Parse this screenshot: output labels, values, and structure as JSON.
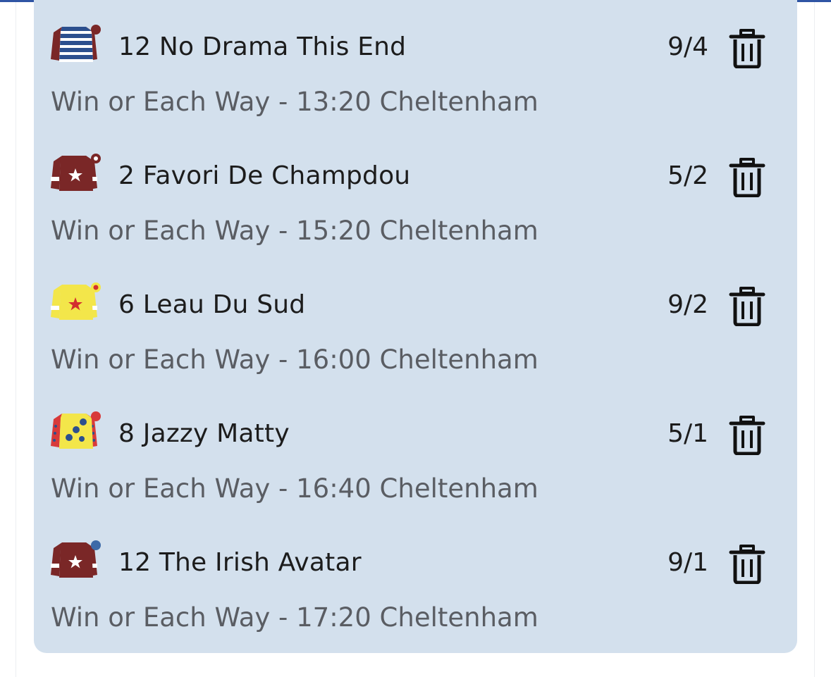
{
  "bets": [
    {
      "selection": "12 No Drama This End",
      "odds": "9/4",
      "market": "Win or Each Way - 13:20 Cheltenham",
      "silk_icon": "blue-white-hooped-silk-icon",
      "delete_icon": "trash-icon"
    },
    {
      "selection": "2 Favori De Champdou",
      "odds": "5/2",
      "market": "Win or Each Way - 15:20 Cheltenham",
      "silk_icon": "maroon-star-silk-icon",
      "delete_icon": "trash-icon"
    },
    {
      "selection": "6 Leau Du Sud",
      "odds": "9/2",
      "market": "Win or Each Way - 16:00 Cheltenham",
      "silk_icon": "yellow-red-star-silk-icon",
      "delete_icon": "trash-icon"
    },
    {
      "selection": "8 Jazzy Matty",
      "odds": "5/1",
      "market": "Win or Each Way - 16:40 Cheltenham",
      "silk_icon": "yellow-blue-spots-silk-icon",
      "delete_icon": "trash-icon"
    },
    {
      "selection": "12 The Irish Avatar",
      "odds": "9/1",
      "market": "Win or Each Way - 17:20 Cheltenham",
      "silk_icon": "maroon-star-blue-cap-silk-icon",
      "delete_icon": "trash-icon"
    }
  ],
  "colors": {
    "card_background": "#d3e0ed",
    "accent_line": "#2f55a4",
    "primary_text": "#1c1c1c",
    "secondary_text": "#5a5d63"
  }
}
